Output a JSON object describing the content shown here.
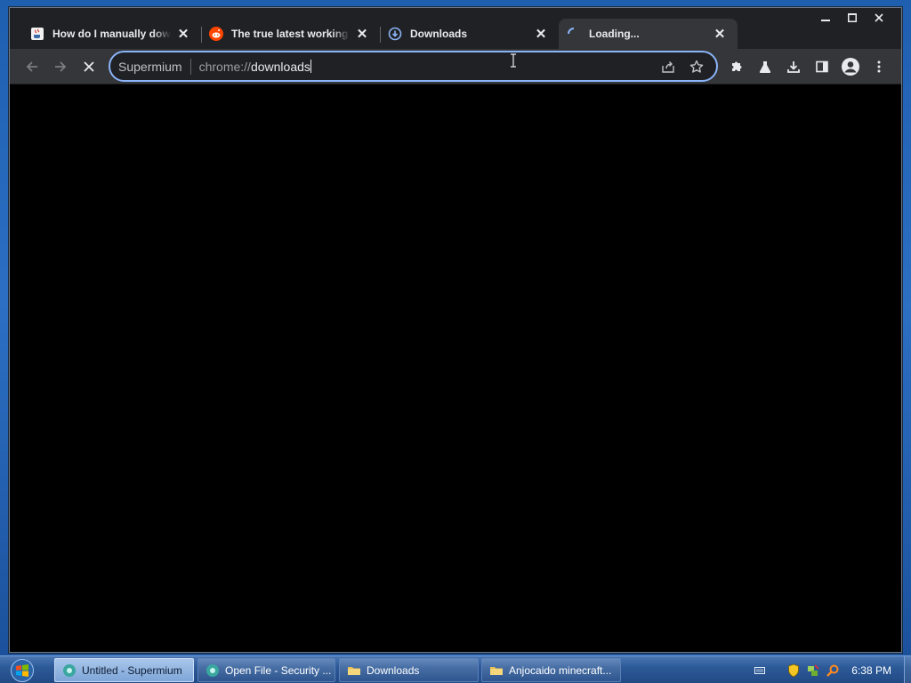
{
  "browser": {
    "tabs": [
      {
        "title": "How do I manually downl",
        "favicon": "java-icon",
        "active": false
      },
      {
        "title": "The true latest working ve",
        "favicon": "reddit-icon",
        "active": false
      },
      {
        "title": "Downloads",
        "favicon": "downloads-icon",
        "active": false
      },
      {
        "title": "Loading...",
        "favicon": "loading-spinner-icon",
        "active": true
      }
    ],
    "omnibox": {
      "chip": "Supermium",
      "url_scheme": "chrome://",
      "url_host": "downloads"
    },
    "colors": {
      "accent": "#8ab4f8",
      "toolbar": "#35363a",
      "titlebar": "#202124"
    }
  },
  "taskbar": {
    "tasks": [
      {
        "label": "Untitled - Supermium",
        "icon": "supermium-icon",
        "active": true
      },
      {
        "label": "Open File - Security ...",
        "icon": "supermium-icon",
        "active": false
      },
      {
        "label": "Downloads",
        "icon": "folder-icon",
        "active": false
      },
      {
        "label": "Anjocaido minecraft...",
        "icon": "folder-icon",
        "active": false
      }
    ],
    "clock": "6:38 PM"
  }
}
